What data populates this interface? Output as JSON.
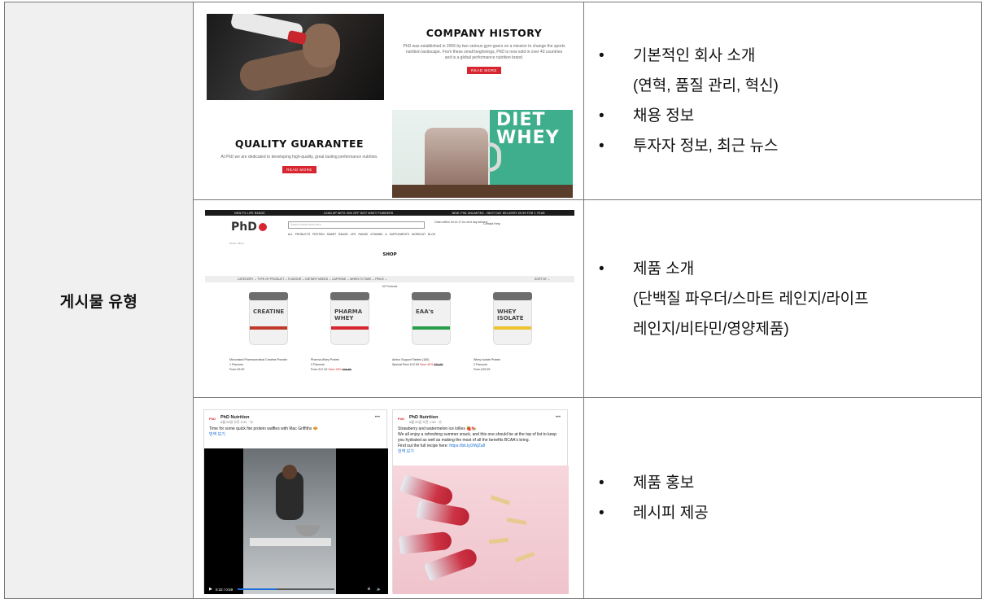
{
  "category_label": "게시물 유형",
  "rows": [
    {
      "bullets": [
        {
          "text": "기본적인 회사 소개",
          "cont": "(연혁, 품질 관리, 혁신)"
        },
        {
          "text": "채용 정보"
        },
        {
          "text": "투자자 정보, 최근 뉴스"
        }
      ],
      "screenshot": {
        "history_title": "COMPANY HISTORY",
        "history_text": "PhD was established in 2006 by two serious gym-goers on a mission to change the sports nutrition landscape. From these small beginnings, PhD is now sold in over 40 countries and is a global performance nutrition brand.",
        "read_more": "READ MORE",
        "quality_title": "QUALITY GUARANTEE",
        "quality_text": "At PhD we are dedicated to developing high-quality, great tasting performance nutrition.",
        "diet_text": "DIET WHEY"
      }
    },
    {
      "bullets": [
        {
          "text": "제품 소개",
          "cont": "(단백질 파우더/스마트 레인지/라이프",
          "cont2": "레인지/비타민/영양제품)"
        }
      ],
      "screenshot": {
        "topbar": [
          "NEW FX LIFE RANGE",
          "LEAN UP WITH 40% OFF DIET WHEY POWDERS",
          "NEW: PhD UNLIMITED - NEXT DAY DELIVERY £9.99 FOR 1 YEAR"
        ],
        "logo": "PhD",
        "search_placeholder": "Search entire store here",
        "order": "Order within 04:11:17 for next day delivery",
        "header_links": "Contact   Help",
        "nav": "ALL PRODUCTS  PROTEIN  SMART RANGE  LIFE RANGE  VITAMINS & SUPPLEMENTS  WORKOUT  BLOG",
        "breadcrumb": "Home / Shop",
        "shop_title": "SHOP",
        "filters": "CATEGORY ⌄   TYPE OF PRODUCT ⌄   FLAVOUR ⌄   DIETARY NEEDS ⌄   CAFFEINE ⌄   WHEN TO TAKE ⌄   PRICE ⌄",
        "sort": "SORT BY ⌄",
        "count": "92 Products",
        "products": [
          {
            "tub": "CREATINE",
            "band": "#c0392b",
            "name": "Micronised Pharmaceutical Creatine Powder",
            "l2": "1 Flavours",
            "l3": "From £9.99"
          },
          {
            "tub": "PHARMA WHEY",
            "band": "#d7262f",
            "name": "Pharma Whey Protein",
            "l2": "2 Flavours",
            "l3": "From £17.49",
            "save": "Save 30%",
            "was": "£24.99"
          },
          {
            "tub": "EAA's",
            "band": "#2a9d4a",
            "name": "Amino Support Tablets (180)",
            "l2": "Special Price £12.59",
            "save": "Save 40%",
            "was": "£20.99"
          },
          {
            "tub": "WHEY ISOLATE",
            "band": "#f0c230",
            "name": "Whey Isolate Protein",
            "l2": "2 Flavours",
            "l3": "From £29.99"
          }
        ]
      }
    },
    {
      "bullets": [
        {
          "text": "제품 홍보"
        },
        {
          "text": "레시피 제공"
        }
      ],
      "screenshot": {
        "post1": {
          "name": "PhD Nutrition",
          "date": "8월 26일 오후 5:31 · ⊘",
          "text": "Time for some quick fire protein waffles with Mac Griffiths 🧇",
          "translate": "번역 보기",
          "time": "0:32 / 0:59"
        },
        "post2": {
          "name": "PhD Nutrition",
          "date": "8월 25일 오전 1:59 · ⊘",
          "line1": "Strawberry and watermelon ice lollies 🍓🍉",
          "line2": "We all enjoy a refreshing summer snack, and this one should be at the top of list to keep you hydrated as well as making the most of all the benefits BCAA's bring.",
          "line3": "Find out the full recipe here: ",
          "link": "https://bit.ly/2WjZa8",
          "translate": "번역 보기"
        }
      }
    }
  ]
}
